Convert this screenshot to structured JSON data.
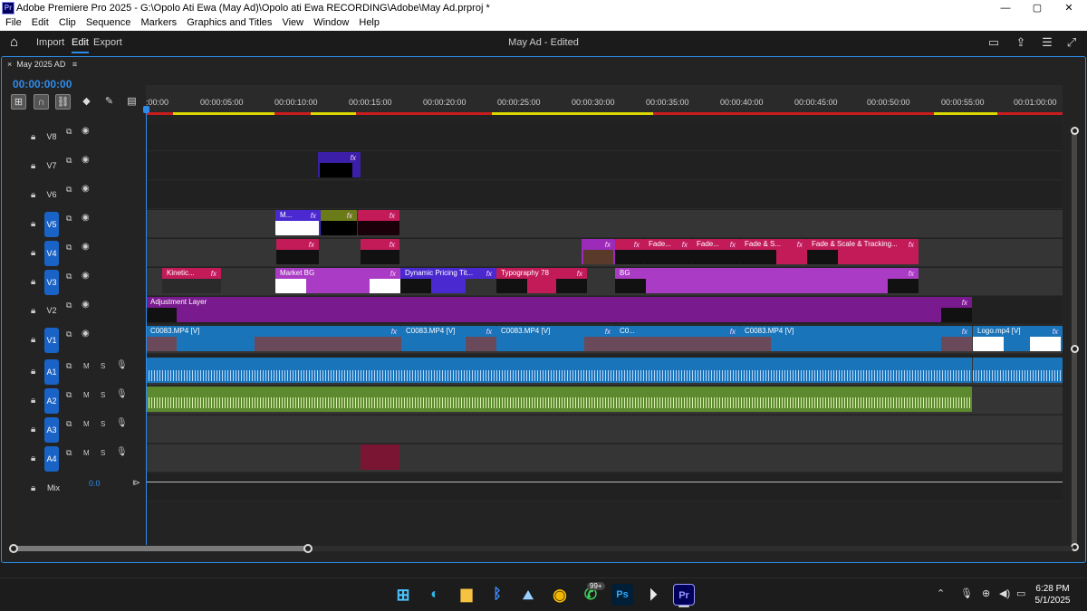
{
  "window": {
    "title": "Adobe Premiere Pro 2025 - G:\\Opolo Ati Ewa (May Ad)\\Opolo ati Ewa RECORDING\\Adobe\\May Ad.prproj *",
    "app_icon": "Pr",
    "controls": {
      "minimize": "—",
      "maximize": "▢",
      "close": "✕"
    }
  },
  "menu": [
    "File",
    "Edit",
    "Clip",
    "Sequence",
    "Markers",
    "Graphics and Titles",
    "View",
    "Window",
    "Help"
  ],
  "header": {
    "tabs": [
      "Import",
      "Edit",
      "Export"
    ],
    "active_tab": "Edit",
    "document_title": "May Ad - Edited"
  },
  "sequence": {
    "close_glyph": "×",
    "name": "May 2025 AD",
    "menu_glyph": "≡",
    "timecode": "00:00:00:00"
  },
  "ruler": {
    "ticks": [
      ":00:00",
      "00:00:05:00",
      "00:00:10:00",
      "00:00:15:00",
      "00:00:20:00",
      "00:00:25:00",
      "00:00:30:00",
      "00:00:35:00",
      "00:00:40:00",
      "00:00:45:00",
      "00:00:50:00",
      "00:00:55:00",
      "00:01:00:00"
    ]
  },
  "tracks": {
    "video": [
      "V8",
      "V7",
      "V6",
      "V5",
      "V4",
      "V3",
      "V2",
      "V1"
    ],
    "audio": [
      "A1",
      "A2",
      "A3",
      "A4"
    ],
    "mix_label": "Mix",
    "mix_value": "0.0",
    "mute_label": "M",
    "solo_label": "S"
  },
  "clips": {
    "v5_m": "M...",
    "v4_fade1": "Fade...",
    "v4_fade2": "Fade...",
    "v4_fade3": "Fade & S...",
    "v4_fade4": "Fade & Scale & Tracking...",
    "v3_kinetic": "Kinetic...",
    "v3_market": "Market BG",
    "v3_dynamic": "Dynamic Pricing Tit...",
    "v3_typo": "Typography 78",
    "v3_bg": "BG",
    "v2_adj": "Adjustment Layer",
    "v1_c1": "C0083.MP4 [V]",
    "v1_c2": "C0083.MP4 [V]",
    "v1_c3": "C0083.MP4 [V]",
    "v1_c4": "C0...",
    "v1_c5": "C0083.MP4 [V]",
    "v1_logo": "Logo.mp4 [V]",
    "fx": "fx"
  },
  "taskbar": {
    "badge": "99+",
    "ps_label": "Ps",
    "pr_label": "Pr",
    "time": "6:28 PM",
    "date": "5/1/2025"
  },
  "colors": {
    "accent": "#2d8ceb",
    "video_clip_blue": "#1a74b9",
    "adjustment_purple": "#7a1a8f",
    "graphic_violet": "#9b2bb8",
    "pink": "#c21b58",
    "audio_green": "#5e8a2f"
  }
}
